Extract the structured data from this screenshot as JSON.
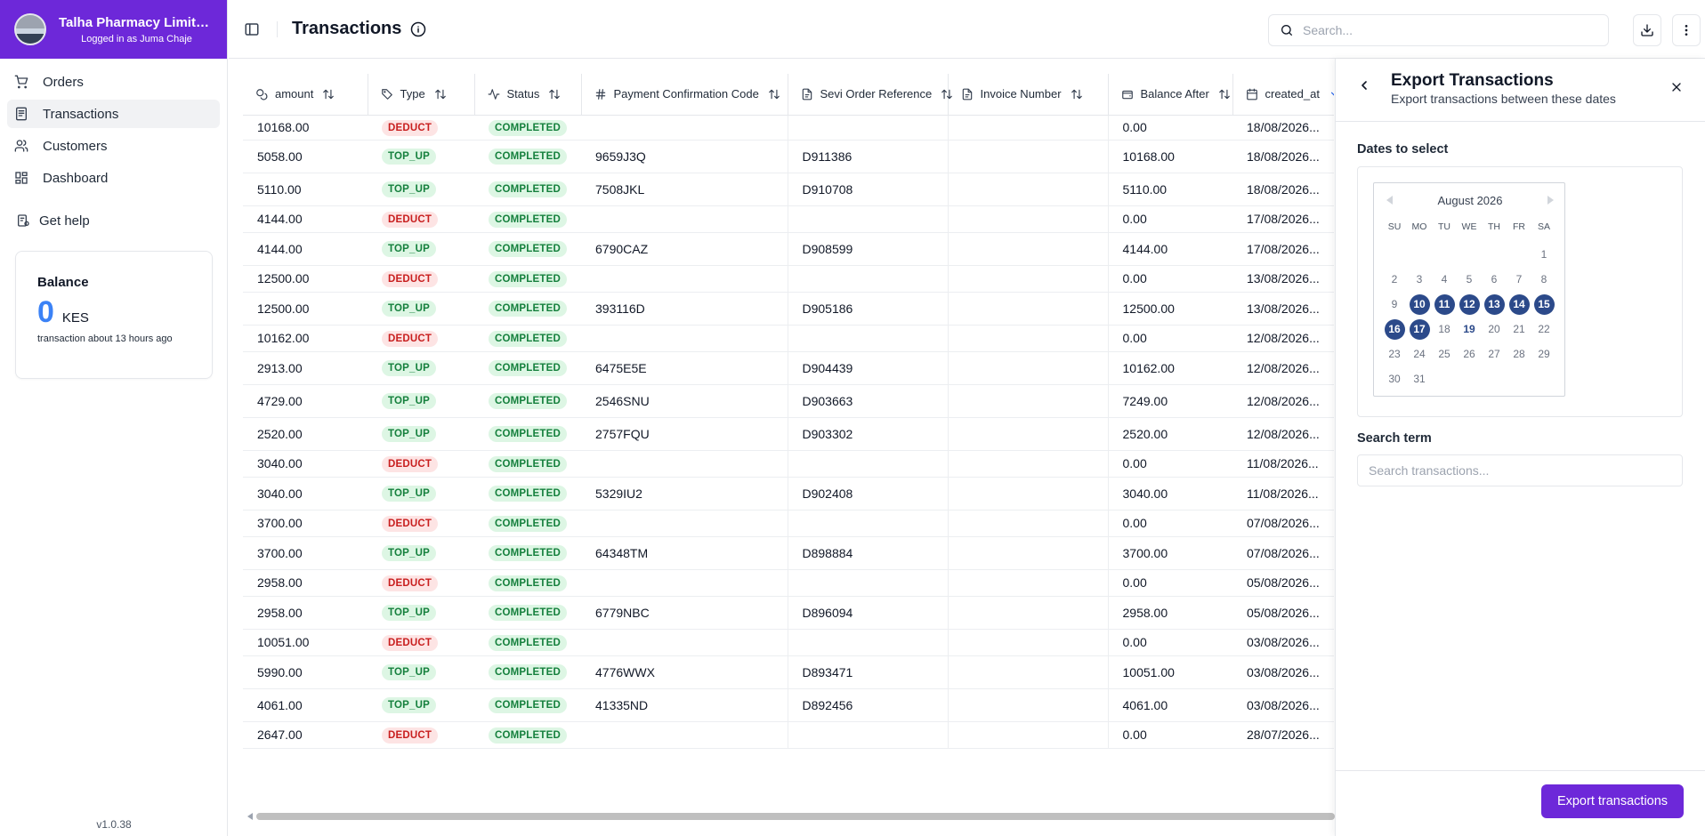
{
  "org": {
    "name": "Talha Pharmacy Limited -...",
    "logged_in": "Logged in as Juma Chaje"
  },
  "nav": {
    "items": [
      {
        "label": "Orders",
        "icon": "cart-icon"
      },
      {
        "label": "Transactions",
        "icon": "receipt-icon",
        "active": true
      },
      {
        "label": "Customers",
        "icon": "users-icon"
      },
      {
        "label": "Dashboard",
        "icon": "grid-icon"
      }
    ],
    "help": "Get help"
  },
  "balance": {
    "title": "Balance",
    "amount": "0",
    "currency": "KES",
    "subtitle": "transaction about 13 hours ago"
  },
  "version": "v1.0.38",
  "header": {
    "title": "Transactions",
    "search_placeholder": "Search..."
  },
  "table": {
    "columns": [
      "amount",
      "Type",
      "Status",
      "Payment Confirmation Code",
      "Sevi Order Reference",
      "Invoice Number",
      "Balance After",
      "created_at"
    ],
    "rows": [
      {
        "amount": "10168.00",
        "type": "DEDUCT",
        "status": "COMPLETED",
        "code": "",
        "ref": "",
        "invoice": "",
        "balance": "0.00",
        "created": "18/08/2026..."
      },
      {
        "amount": "5058.00",
        "type": "TOP_UP",
        "status": "COMPLETED",
        "code": "9659J3Q",
        "ref": "D911386",
        "invoice": "",
        "balance": "10168.00",
        "created": "18/08/2026..."
      },
      {
        "amount": "5110.00",
        "type": "TOP_UP",
        "status": "COMPLETED",
        "code": "7508JKL",
        "ref": "D910708",
        "invoice": "",
        "balance": "5110.00",
        "created": "18/08/2026..."
      },
      {
        "amount": "4144.00",
        "type": "DEDUCT",
        "status": "COMPLETED",
        "code": "",
        "ref": "",
        "invoice": "",
        "balance": "0.00",
        "created": "17/08/2026..."
      },
      {
        "amount": "4144.00",
        "type": "TOP_UP",
        "status": "COMPLETED",
        "code": "6790CAZ",
        "ref": "D908599",
        "invoice": "",
        "balance": "4144.00",
        "created": "17/08/2026..."
      },
      {
        "amount": "12500.00",
        "type": "DEDUCT",
        "status": "COMPLETED",
        "code": "",
        "ref": "",
        "invoice": "",
        "balance": "0.00",
        "created": "13/08/2026..."
      },
      {
        "amount": "12500.00",
        "type": "TOP_UP",
        "status": "COMPLETED",
        "code": "393116D",
        "ref": "D905186",
        "invoice": "",
        "balance": "12500.00",
        "created": "13/08/2026..."
      },
      {
        "amount": "10162.00",
        "type": "DEDUCT",
        "status": "COMPLETED",
        "code": "",
        "ref": "",
        "invoice": "",
        "balance": "0.00",
        "created": "12/08/2026..."
      },
      {
        "amount": "2913.00",
        "type": "TOP_UP",
        "status": "COMPLETED",
        "code": "6475E5E",
        "ref": "D904439",
        "invoice": "",
        "balance": "10162.00",
        "created": "12/08/2026..."
      },
      {
        "amount": "4729.00",
        "type": "TOP_UP",
        "status": "COMPLETED",
        "code": "2546SNU",
        "ref": "D903663",
        "invoice": "",
        "balance": "7249.00",
        "created": "12/08/2026..."
      },
      {
        "amount": "2520.00",
        "type": "TOP_UP",
        "status": "COMPLETED",
        "code": "2757FQU",
        "ref": "D903302",
        "invoice": "",
        "balance": "2520.00",
        "created": "12/08/2026..."
      },
      {
        "amount": "3040.00",
        "type": "DEDUCT",
        "status": "COMPLETED",
        "code": "",
        "ref": "",
        "invoice": "",
        "balance": "0.00",
        "created": "11/08/2026..."
      },
      {
        "amount": "3040.00",
        "type": "TOP_UP",
        "status": "COMPLETED",
        "code": "5329IU2",
        "ref": "D902408",
        "invoice": "",
        "balance": "3040.00",
        "created": "11/08/2026..."
      },
      {
        "amount": "3700.00",
        "type": "DEDUCT",
        "status": "COMPLETED",
        "code": "",
        "ref": "",
        "invoice": "",
        "balance": "0.00",
        "created": "07/08/2026..."
      },
      {
        "amount": "3700.00",
        "type": "TOP_UP",
        "status": "COMPLETED",
        "code": "64348TM",
        "ref": "D898884",
        "invoice": "",
        "balance": "3700.00",
        "created": "07/08/2026..."
      },
      {
        "amount": "2958.00",
        "type": "DEDUCT",
        "status": "COMPLETED",
        "code": "",
        "ref": "",
        "invoice": "",
        "balance": "0.00",
        "created": "05/08/2026..."
      },
      {
        "amount": "2958.00",
        "type": "TOP_UP",
        "status": "COMPLETED",
        "code": "6779NBC",
        "ref": "D896094",
        "invoice": "",
        "balance": "2958.00",
        "created": "05/08/2026..."
      },
      {
        "amount": "10051.00",
        "type": "DEDUCT",
        "status": "COMPLETED",
        "code": "",
        "ref": "",
        "invoice": "",
        "balance": "0.00",
        "created": "03/08/2026..."
      },
      {
        "amount": "5990.00",
        "type": "TOP_UP",
        "status": "COMPLETED",
        "code": "4776WWX",
        "ref": "D893471",
        "invoice": "",
        "balance": "10051.00",
        "created": "03/08/2026..."
      },
      {
        "amount": "4061.00",
        "type": "TOP_UP",
        "status": "COMPLETED",
        "code": "41335ND",
        "ref": "D892456",
        "invoice": "",
        "balance": "4061.00",
        "created": "03/08/2026..."
      },
      {
        "amount": "2647.00",
        "type": "DEDUCT",
        "status": "COMPLETED",
        "code": "",
        "ref": "",
        "invoice": "",
        "balance": "0.00",
        "created": "28/07/2026..."
      }
    ]
  },
  "panel": {
    "title": "Export Transactions",
    "subtitle": "Export transactions between these dates",
    "dates_label": "Dates to select",
    "calendar": {
      "month": "August 2026",
      "weekdays": [
        "SU",
        "MO",
        "TU",
        "WE",
        "TH",
        "FR",
        "SA"
      ],
      "first_weekday": 6,
      "days_in_month": 31,
      "selected": [
        10,
        11,
        12,
        13,
        14,
        15,
        16,
        17
      ],
      "today": 19
    },
    "search_label": "Search term",
    "search_placeholder": "Search transactions...",
    "export_label": "Export transactions"
  },
  "colors": {
    "brand": "#6d28d9",
    "selected_day": "#2c4a8a",
    "balance": "#3b82f6",
    "deduct": "#c81e1e",
    "topup": "#15803d"
  }
}
